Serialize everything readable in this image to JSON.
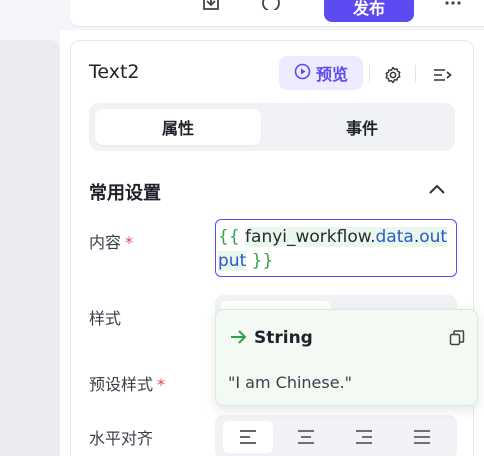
{
  "toolbar": {
    "publish_label": "发布"
  },
  "panel": {
    "title": "Text2",
    "preview_label": "预览",
    "tabs": [
      {
        "label": "属性",
        "active": true
      },
      {
        "label": "事件",
        "active": false
      }
    ]
  },
  "section": {
    "title": "常用设置"
  },
  "fields": {
    "content_label": "内容",
    "style_label": "样式",
    "preset_style_label": "预设样式",
    "align_label": "水平对齐",
    "required_mark": "*"
  },
  "content_expression": {
    "open": "{{",
    "object": "fanyi_workflow",
    "dot1": ".",
    "data": "data",
    "dot2": ".",
    "output": "output",
    "close": "}}"
  },
  "popover": {
    "type_label": "String",
    "value": "\"I am Chinese.\""
  },
  "colors": {
    "accent": "#5b4bf0",
    "required": "#e5484d",
    "brace": "#2fa447",
    "property": "#2b57c9"
  }
}
